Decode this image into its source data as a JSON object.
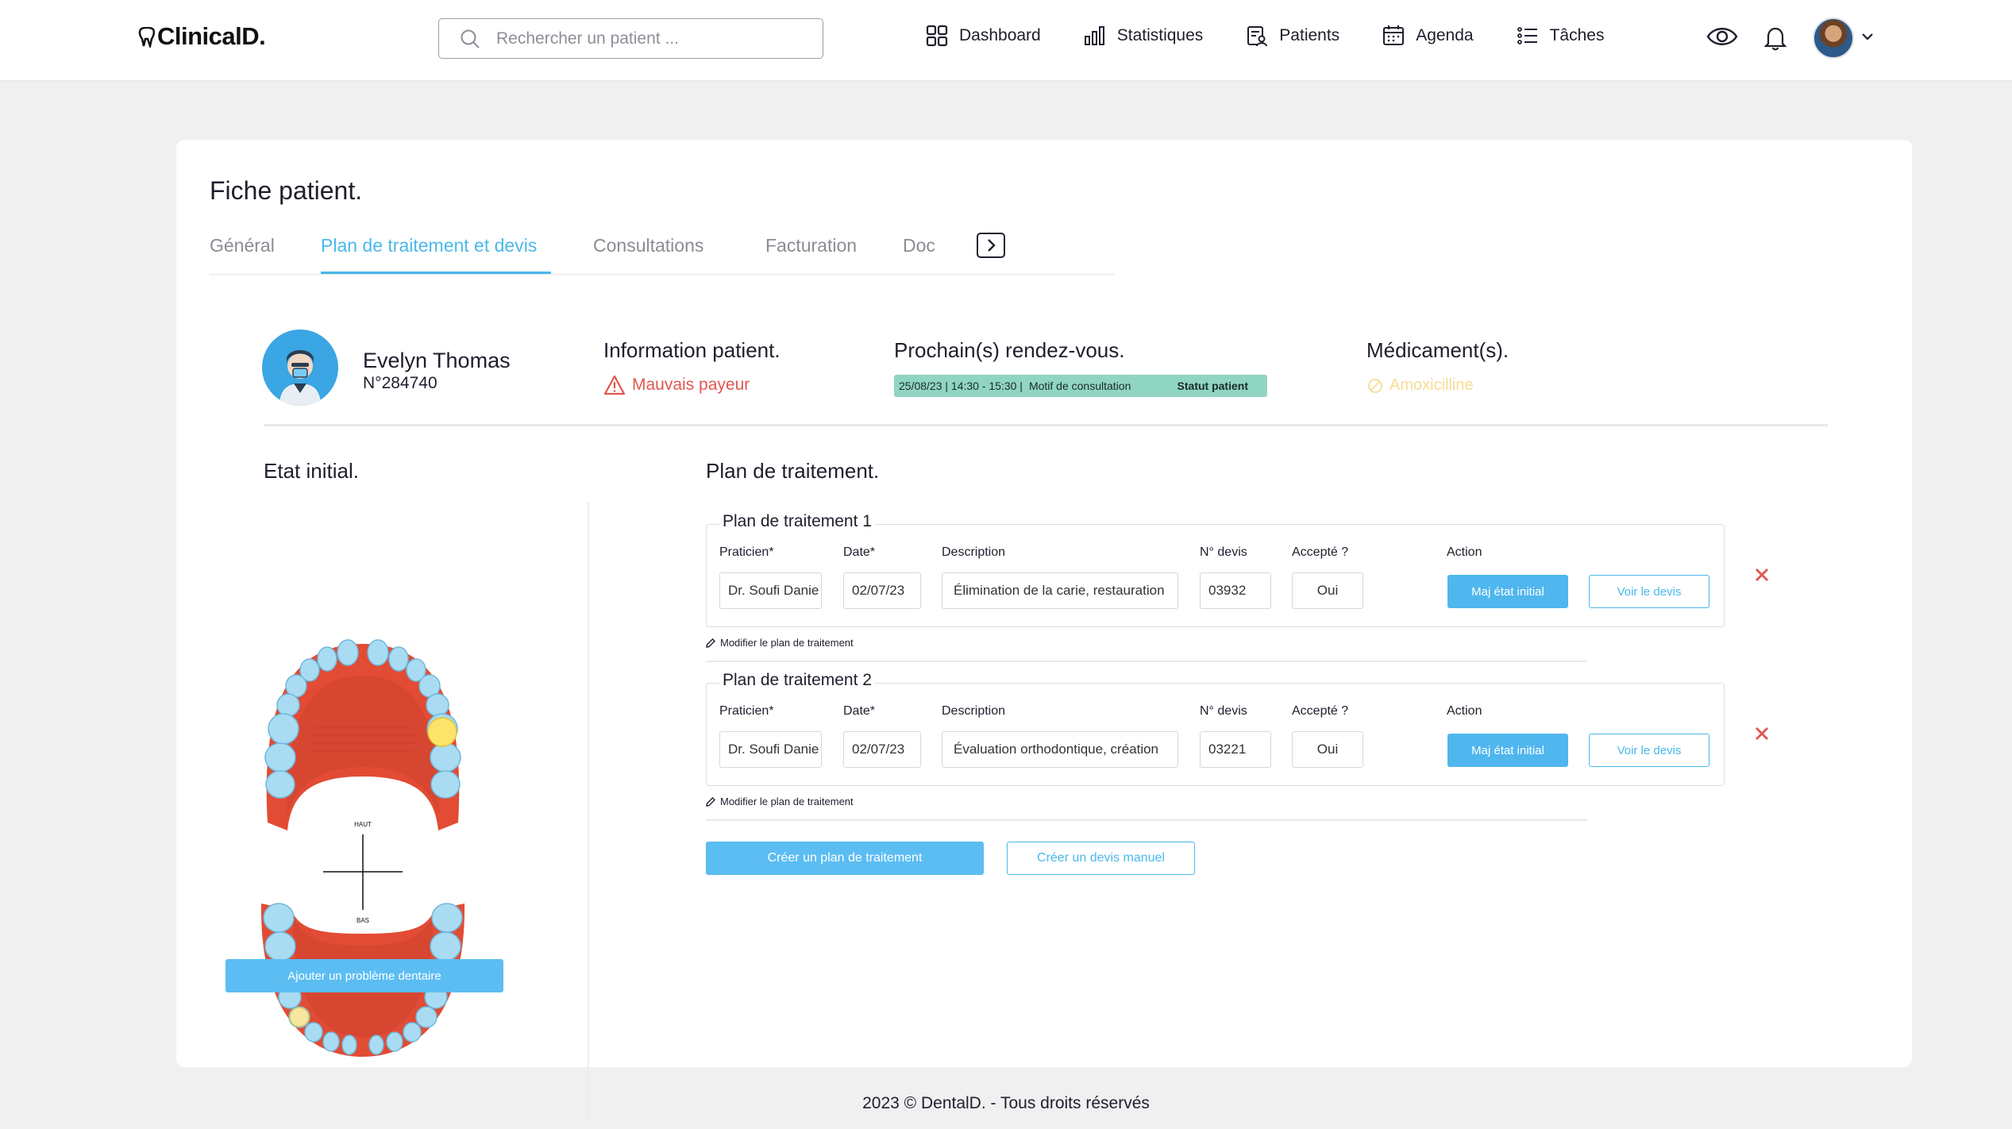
{
  "brand": {
    "logo_text": "ClinicalD."
  },
  "search": {
    "placeholder": "Rechercher un patient ..."
  },
  "nav": {
    "items": [
      {
        "label": "Dashboard",
        "icon": "grid-icon"
      },
      {
        "label": "Statistiques",
        "icon": "bar-chart-icon"
      },
      {
        "label": "Patients",
        "icon": "patients-icon"
      },
      {
        "label": "Agenda",
        "icon": "calendar-icon"
      },
      {
        "label": "Tâches",
        "icon": "task-list-icon"
      }
    ]
  },
  "page": {
    "title": "Fiche patient."
  },
  "tabs": [
    "Général",
    "Plan de traitement et devis",
    "Consultations",
    "Facturation",
    "Doc"
  ],
  "active_tab": "Plan de traitement et devis",
  "patient": {
    "name": "Evelyn Thomas",
    "id": "N°284740"
  },
  "info": {
    "title": "Information patient.",
    "warning": "Mauvais payeur"
  },
  "rdv": {
    "title": "Prochain(s) rendez-vous.",
    "date": "25/08/23 | 14:30 - 15:30 |",
    "motif": "Motif de consultation",
    "status": "Statut patient"
  },
  "meds": {
    "title": "Médicament(s).",
    "item": "Amoxicilline"
  },
  "etat": {
    "title": "Etat initial.",
    "upper_label": "HAUT",
    "lower_label": "BAS",
    "add_button": "Ajouter un problème dentaire"
  },
  "plan": {
    "title": "Plan de traitement.",
    "columns": {
      "praticien": "Praticien*",
      "date": "Date*",
      "description": "Description",
      "devis": "N° devis",
      "accepte": "Accepté ?",
      "action": "Action"
    },
    "items": [
      {
        "name": "Plan de traitement 1",
        "praticien": "Dr. Soufi Danie",
        "date": "02/07/23",
        "description": "Élimination de la carie, restauration",
        "devis": "03932",
        "accepte": "Oui",
        "maj": "Maj état initial",
        "voir": "Voir le devis",
        "modify": "Modifier le plan de traitement"
      },
      {
        "name": "Plan de traitement 2",
        "praticien": "Dr. Soufi Danie",
        "date": "02/07/23",
        "description": "Évaluation orthodontique, création",
        "devis": "03221",
        "accepte": "Oui",
        "maj": "Maj état initial",
        "voir": "Voir le devis",
        "modify": "Modifier le plan de traitement"
      }
    ],
    "create_button": "Créer un plan de traitement",
    "manual_button": "Créer un devis manuel"
  },
  "colors": {
    "accent": "#4ab8eb",
    "danger": "#e0574f",
    "rdv_pill": "#8fd5c2",
    "med": "#f6dc94"
  },
  "footer": {
    "text": "2023 © DentalD. -  Tous droits réservés"
  }
}
